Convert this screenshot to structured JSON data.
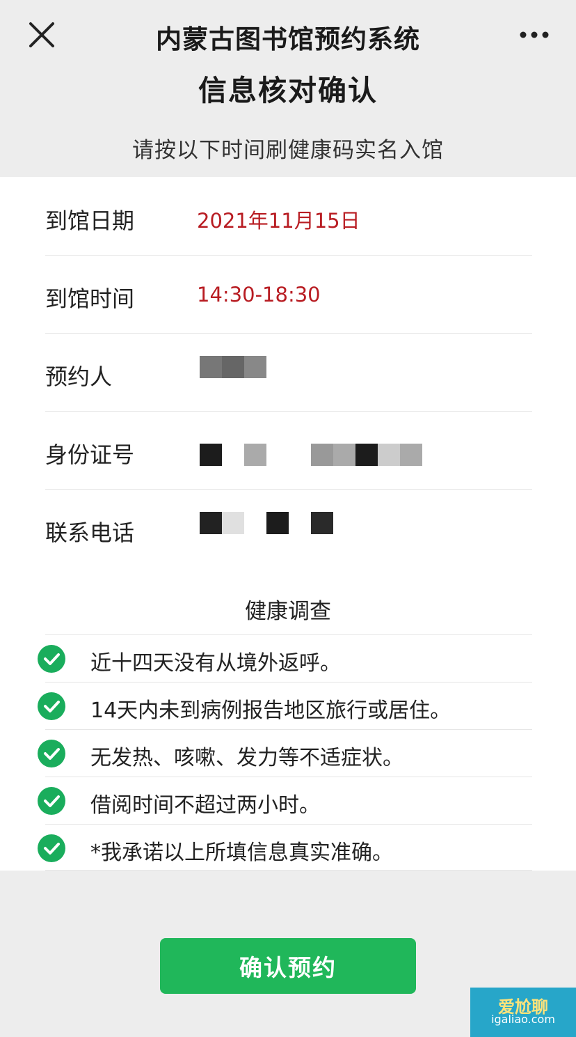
{
  "nav": {
    "title": "内蒙古图书馆预约系统",
    "close_icon": "close-icon",
    "more_icon": "more-icon"
  },
  "page": {
    "title": "信息核对确认",
    "subtitle": "请按以下时间刷健康码实名入馆"
  },
  "info": {
    "date_label": "到馆日期",
    "date_value": "2021年11月15日",
    "time_label": "到馆时间",
    "time_value": "14:30-18:30",
    "name_label": "预约人",
    "id_label": "身份证号",
    "phone_label": "联系电话"
  },
  "survey": {
    "title": "健康调查",
    "items": [
      "近十四天没有从境外返呼。",
      "14天内未到病例报告地区旅行或居住。",
      "无发热、咳嗽、发力等不适症状。",
      "借阅时间不超过两小时。",
      "*我承诺以上所填信息真实准确。"
    ]
  },
  "confirm_button": "确认预约",
  "watermark": {
    "text": "爱尬聊",
    "url": "igaliao.com"
  },
  "colors": {
    "accent_green": "#20b75a",
    "value_red": "#b81c22",
    "background": "#ededed"
  }
}
